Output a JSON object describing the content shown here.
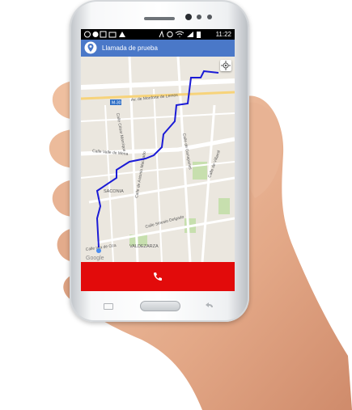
{
  "status_bar": {
    "time": "11:22",
    "left_icons": [
      "whatsapp-icon",
      "skype-icon",
      "image-icon",
      "mail-icon",
      "signal-icon"
    ],
    "right_icons": [
      "activity-icon",
      "alarm-icon",
      "wifi-icon",
      "signal-bars-icon",
      "battery-icon"
    ]
  },
  "app_bar": {
    "title": "Llamada de prueba",
    "icon": "location-marker-icon",
    "color": "#4a78c8"
  },
  "map": {
    "labels": {
      "road_m30": "M-30",
      "av_monforte": "Av. de Monforte de Lemos",
      "calle_cesar_manrique": "Calle César Manrique",
      "calle_valle_de_mena": "Calle Valle de Mena",
      "calle_ganapanes": "Calle de Ganapanes",
      "calle_antonio_machado": "Calle de Antonio Machado",
      "saconia": "SACONIA",
      "calle_villamil": "Calle de Villamil",
      "calle_sinesio_delgado": "Calle Sinesio Delgado",
      "valdezarza": "VALDEZARZA",
      "calle_isla_de_oza": "Calle Isla de Oza",
      "google": "Google"
    },
    "route_color": "#1b1bd6",
    "origin_color": "#4a8cf0",
    "locate_icon": "crosshair-icon"
  },
  "call_bar": {
    "color": "#e20b0b",
    "icon": "hangup-phone-icon"
  }
}
